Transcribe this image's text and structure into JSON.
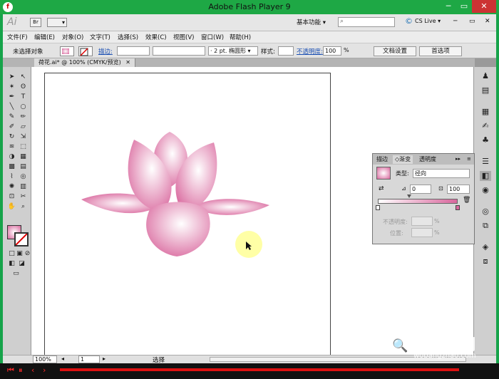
{
  "window": {
    "title": "Adobe Flash Player 9",
    "icon_glyph": "f",
    "minimize": "─",
    "maximize": "▭",
    "close": "✕"
  },
  "appbar": {
    "logo": "Ai",
    "workspace": "基本功能 ▾",
    "cslive": "CS Live ▾",
    "search_placeholder": "",
    "bridge_label": "Br",
    "arrange_label": "▾"
  },
  "menu": {
    "items": [
      "文件(F)",
      "编辑(E)",
      "对象(O)",
      "文字(T)",
      "选择(S)",
      "效果(C)",
      "视图(V)",
      "窗口(W)",
      "帮助(H)"
    ]
  },
  "control": {
    "selection": "未选择对象",
    "stroke_label": "描边:",
    "stroke_value": "",
    "brush_value": "· 2 pt. 椭圆形 ▾",
    "style_label": "样式:",
    "opacity_label": "不透明度:",
    "opacity_value": "100",
    "opacity_unit": "%",
    "doc_settings": "文档设置",
    "preferences": "首选项"
  },
  "tab": {
    "label": "荷花.ai* @ 100% (CMYK/预览)",
    "close": "✕"
  },
  "gradient_panel": {
    "tabs": [
      "描边",
      "◇渐变",
      "透明度"
    ],
    "type_label": "类型:",
    "type_value": "径向",
    "angle_value": "0",
    "ratio_value": "100",
    "opacity_label": "不透明度:",
    "opacity_unit": "%",
    "location_label": "位置:",
    "location_unit": "%"
  },
  "status": {
    "zoom": "100%",
    "page": "1",
    "mode": "选择"
  },
  "watermark": {
    "text": "我帮找网",
    "url": "wobangzhao.com"
  },
  "colors": {
    "petal_dark": "#d9679d",
    "petal_light": "#ffffff",
    "accent_green": "#1ea845",
    "player_red": "#dd1111"
  }
}
